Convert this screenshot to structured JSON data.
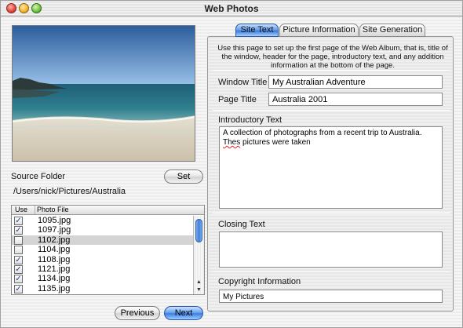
{
  "window": {
    "title": "Web Photos"
  },
  "photo": {
    "alt": ""
  },
  "source": {
    "label": "Source Folder",
    "set_button": "Set",
    "path": "/Users/nick/Pictures/Australia"
  },
  "file_list": {
    "col_use": "Use",
    "col_file": "Photo File",
    "rows": [
      {
        "file": "1095.jpg",
        "checked": true,
        "selected": false
      },
      {
        "file": "1097.jpg",
        "checked": true,
        "selected": false
      },
      {
        "file": "1102.jpg",
        "checked": false,
        "selected": true
      },
      {
        "file": "1104.jpg",
        "checked": false,
        "selected": false
      },
      {
        "file": "1108.jpg",
        "checked": true,
        "selected": false
      },
      {
        "file": "1121.jpg",
        "checked": true,
        "selected": false
      },
      {
        "file": "1134.jpg",
        "checked": true,
        "selected": false
      },
      {
        "file": "1135.jpg",
        "checked": true,
        "selected": false
      }
    ]
  },
  "nav": {
    "previous": "Previous",
    "next": "Next"
  },
  "tabs": [
    {
      "label": "Site Text",
      "active": true
    },
    {
      "label": "Picture Information",
      "active": false
    },
    {
      "label": "Site Generation",
      "active": false
    }
  ],
  "site_text": {
    "description": "Use this page to set up the first page of the Web Album, that is, title of the window, header for the page, introductory text, and any addition information at the bottom of the page.",
    "window_title_label": "Window Title",
    "window_title_value": "My Australian Adventure",
    "page_title_label": "Page Title",
    "page_title_value": "Australia 2001",
    "intro_label": "Introductory Text",
    "intro_value_1": "A collection of photographs from a recent trip to Australia.",
    "intro_value_misspelled": "Thes",
    "intro_value_2": "pictures were taken",
    "closing_label": "Closing Text",
    "closing_value": "",
    "copyright_label": "Copyright Information",
    "copyright_value": "My Pictures"
  },
  "colors": {
    "accent": "#3a78d8",
    "spell_error": "#e02020"
  }
}
